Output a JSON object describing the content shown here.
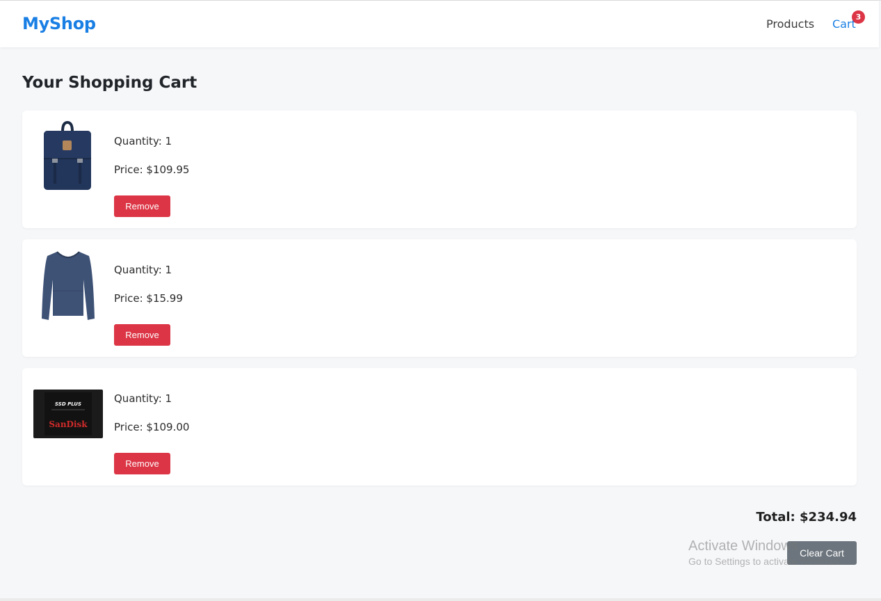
{
  "header": {
    "brand": "MyShop",
    "nav": {
      "products": "Products",
      "cart": "Cart",
      "cart_count": "3"
    }
  },
  "page": {
    "title": "Your Shopping Cart"
  },
  "cart": {
    "items": [
      {
        "image_icon": "backpack-image",
        "quantity_text": "Quantity: 1",
        "price_text": "Price: $109.95",
        "remove_label": "Remove"
      },
      {
        "image_icon": "tshirt-image",
        "quantity_text": "Quantity: 1",
        "price_text": "Price: $15.99",
        "remove_label": "Remove"
      },
      {
        "image_icon": "ssd-image",
        "quantity_text": "Quantity: 1",
        "price_text": "Price: $109.00",
        "remove_label": "Remove"
      }
    ],
    "total_text": "Total: $234.94",
    "clear_label": "Clear Cart"
  },
  "watermark": {
    "title": "Activate Windows",
    "subtitle": "Go to Settings to activate Windows."
  },
  "colors": {
    "brand": "#1a7fe4",
    "remove": "#dc3545",
    "clear": "#6c757d",
    "badge": "#dc3545",
    "background": "#f6f7f9"
  }
}
